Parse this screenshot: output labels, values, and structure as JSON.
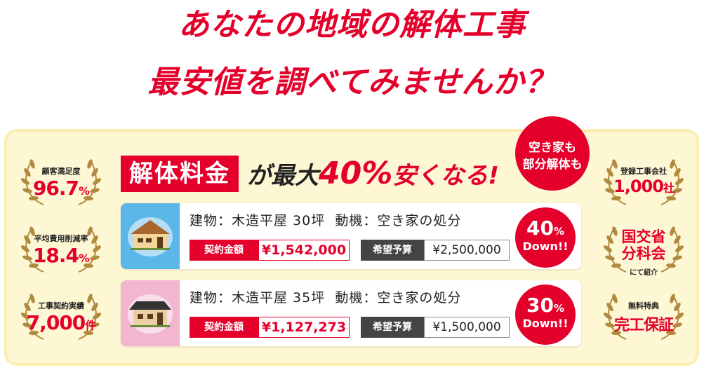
{
  "headline": {
    "line1_pre": "あなたの",
    "line1_hl1": "地域",
    "line1_mid": "の",
    "line1_hl2": "解体工事",
    "line2_hl": "最安値",
    "line2_rest": "を調べてみませんか？"
  },
  "left_badges": [
    {
      "label": "顧客満足度",
      "value": "96.7",
      "unit": "%"
    },
    {
      "label": "平均費用削減率",
      "value": "18.4",
      "unit": "%"
    },
    {
      "label": "工事契約実績",
      "value": "7,000",
      "unit": "件"
    }
  ],
  "right_badges": [
    {
      "label": "登録工事会社",
      "value": "1,000",
      "unit": "社"
    },
    {
      "line1": "国交省",
      "line2": "分科会",
      "sub": "にて紹介"
    },
    {
      "label": "無料特典",
      "value": "完工保証"
    }
  ],
  "promo": {
    "box": "解体料金",
    "ga": "が最大",
    "pct": "40%",
    "rest": "安くなる!",
    "bubble_line1": "空き家も",
    "bubble_line2": "部分解体も"
  },
  "cards": [
    {
      "building": "建物：木造平屋 30坪",
      "motive": "動機：空き家の処分",
      "contract_label": "契約金額",
      "contract_value": "¥1,542,000",
      "budget_label": "希望予算",
      "budget_value": "¥2,500,000",
      "down_pct": "40",
      "down_unit": "%",
      "down_text": "Down!!"
    },
    {
      "building": "建物：木造平屋 35坪",
      "motive": "動機：空き家の処分",
      "contract_label": "契約金額",
      "contract_value": "¥1,127,273",
      "budget_label": "希望予算",
      "budget_value": "¥1,500,000",
      "down_pct": "30",
      "down_unit": "%",
      "down_text": "Down!!"
    }
  ],
  "colors": {
    "red": "#e4002b",
    "yellow_highlight": "#f5f218",
    "panel": "#fef7d4",
    "wreath_gold": "#b08a3e",
    "card1_thumb": "#5bb7e8",
    "card2_thumb": "#f2b6cf"
  }
}
